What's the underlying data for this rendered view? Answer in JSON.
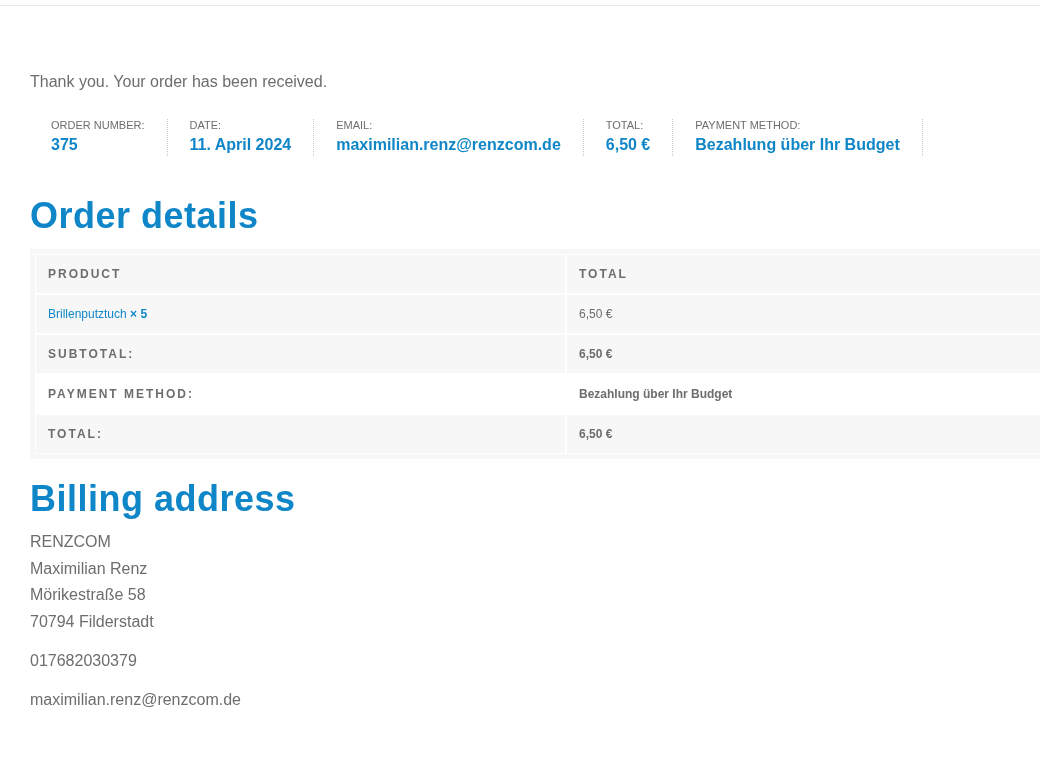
{
  "notice": "Thank you. Your order has been received.",
  "overview": [
    {
      "label": "ORDER NUMBER:",
      "value": "375"
    },
    {
      "label": "DATE:",
      "value": "11. April 2024"
    },
    {
      "label": "EMAIL:",
      "value": "maximilian.renz@renzcom.de"
    },
    {
      "label": "TOTAL:",
      "value": "6,50 €"
    },
    {
      "label": "PAYMENT METHOD:",
      "value": "Bezahlung über Ihr Budget"
    }
  ],
  "order_details": {
    "title": "Order details",
    "columns": [
      "PRODUCT",
      "TOTAL"
    ],
    "rows": [
      {
        "kind": "item",
        "product": "Brillenputztuch **× 5**",
        "total": "6,50 €"
      },
      {
        "kind": "footer",
        "label": "SUBTOTAL:",
        "value": "6,50 €"
      },
      {
        "kind": "footer",
        "label": "PAYMENT METHOD:",
        "value": "Bezahlung über Ihr Budget"
      },
      {
        "kind": "footer",
        "label": "TOTAL:",
        "value": "6,50 €"
      }
    ]
  },
  "billing_address": {
    "title": "Billing address",
    "lines": [
      "RENZCOM",
      "Maximilian Renz",
      "Mörikestraße 58",
      "70794 Filderstadt"
    ],
    "phone": "017682030379",
    "email": "maximilian.renz@renzcom.de"
  }
}
